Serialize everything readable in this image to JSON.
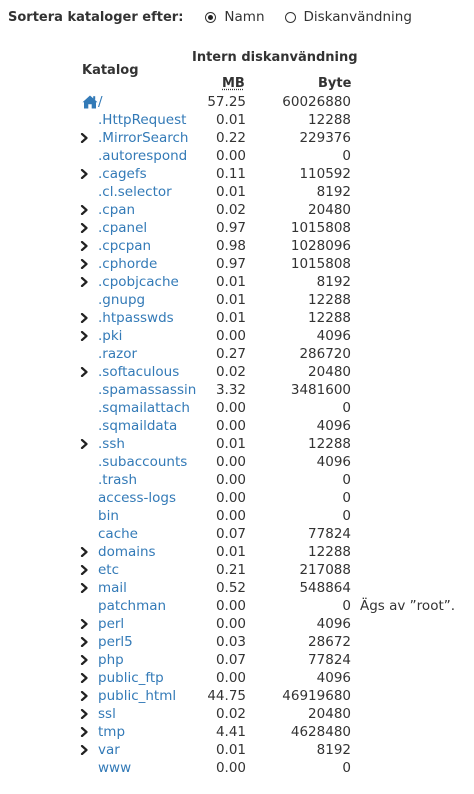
{
  "sort": {
    "label": "Sortera kataloger efter:",
    "options": [
      {
        "label": "Namn",
        "checked": true
      },
      {
        "label": "Diskanvändning",
        "checked": false
      }
    ]
  },
  "table": {
    "header_katalog": "Katalog",
    "header_usage": "Intern diskanvändning",
    "header_mb": "MB",
    "header_byte": "Byte",
    "rows": [
      {
        "name": "/",
        "mb": "57.25",
        "byte": "60026880",
        "expandable": false,
        "home": true
      },
      {
        "name": ".HttpRequest",
        "mb": "0.01",
        "byte": "12288",
        "expandable": false
      },
      {
        "name": ".MirrorSearch",
        "mb": "0.22",
        "byte": "229376",
        "expandable": true
      },
      {
        "name": ".autorespond",
        "mb": "0.00",
        "byte": "0",
        "expandable": false
      },
      {
        "name": ".cagefs",
        "mb": "0.11",
        "byte": "110592",
        "expandable": true
      },
      {
        "name": ".cl.selector",
        "mb": "0.01",
        "byte": "8192",
        "expandable": false
      },
      {
        "name": ".cpan",
        "mb": "0.02",
        "byte": "20480",
        "expandable": true
      },
      {
        "name": ".cpanel",
        "mb": "0.97",
        "byte": "1015808",
        "expandable": true
      },
      {
        "name": ".cpcpan",
        "mb": "0.98",
        "byte": "1028096",
        "expandable": true
      },
      {
        "name": ".cphorde",
        "mb": "0.97",
        "byte": "1015808",
        "expandable": true
      },
      {
        "name": ".cpobjcache",
        "mb": "0.01",
        "byte": "8192",
        "expandable": true
      },
      {
        "name": ".gnupg",
        "mb": "0.01",
        "byte": "12288",
        "expandable": false
      },
      {
        "name": ".htpasswds",
        "mb": "0.01",
        "byte": "12288",
        "expandable": true
      },
      {
        "name": ".pki",
        "mb": "0.00",
        "byte": "4096",
        "expandable": true
      },
      {
        "name": ".razor",
        "mb": "0.27",
        "byte": "286720",
        "expandable": false
      },
      {
        "name": ".softaculous",
        "mb": "0.02",
        "byte": "20480",
        "expandable": true
      },
      {
        "name": ".spamassassin",
        "mb": "3.32",
        "byte": "3481600",
        "expandable": false
      },
      {
        "name": ".sqmailattach",
        "mb": "0.00",
        "byte": "0",
        "expandable": false
      },
      {
        "name": ".sqmaildata",
        "mb": "0.00",
        "byte": "4096",
        "expandable": false
      },
      {
        "name": ".ssh",
        "mb": "0.01",
        "byte": "12288",
        "expandable": true
      },
      {
        "name": ".subaccounts",
        "mb": "0.00",
        "byte": "4096",
        "expandable": false
      },
      {
        "name": ".trash",
        "mb": "0.00",
        "byte": "0",
        "expandable": false
      },
      {
        "name": "access-logs",
        "mb": "0.00",
        "byte": "0",
        "expandable": false
      },
      {
        "name": "bin",
        "mb": "0.00",
        "byte": "0",
        "expandable": false
      },
      {
        "name": "cache",
        "mb": "0.07",
        "byte": "77824",
        "expandable": false
      },
      {
        "name": "domains",
        "mb": "0.01",
        "byte": "12288",
        "expandable": true
      },
      {
        "name": "etc",
        "mb": "0.21",
        "byte": "217088",
        "expandable": true
      },
      {
        "name": "mail",
        "mb": "0.52",
        "byte": "548864",
        "expandable": true
      },
      {
        "name": "patchman",
        "mb": "0.00",
        "byte": "0",
        "expandable": false,
        "note": "Ägs av ”root”."
      },
      {
        "name": "perl",
        "mb": "0.00",
        "byte": "4096",
        "expandable": true
      },
      {
        "name": "perl5",
        "mb": "0.03",
        "byte": "28672",
        "expandable": true
      },
      {
        "name": "php",
        "mb": "0.07",
        "byte": "77824",
        "expandable": true
      },
      {
        "name": "public_ftp",
        "mb": "0.00",
        "byte": "4096",
        "expandable": true
      },
      {
        "name": "public_html",
        "mb": "44.75",
        "byte": "46919680",
        "expandable": true
      },
      {
        "name": "ssl",
        "mb": "0.02",
        "byte": "20480",
        "expandable": true
      },
      {
        "name": "tmp",
        "mb": "4.41",
        "byte": "4628480",
        "expandable": true
      },
      {
        "name": "var",
        "mb": "0.01",
        "byte": "8192",
        "expandable": true
      },
      {
        "name": "www",
        "mb": "0.00",
        "byte": "0",
        "expandable": false
      }
    ]
  }
}
